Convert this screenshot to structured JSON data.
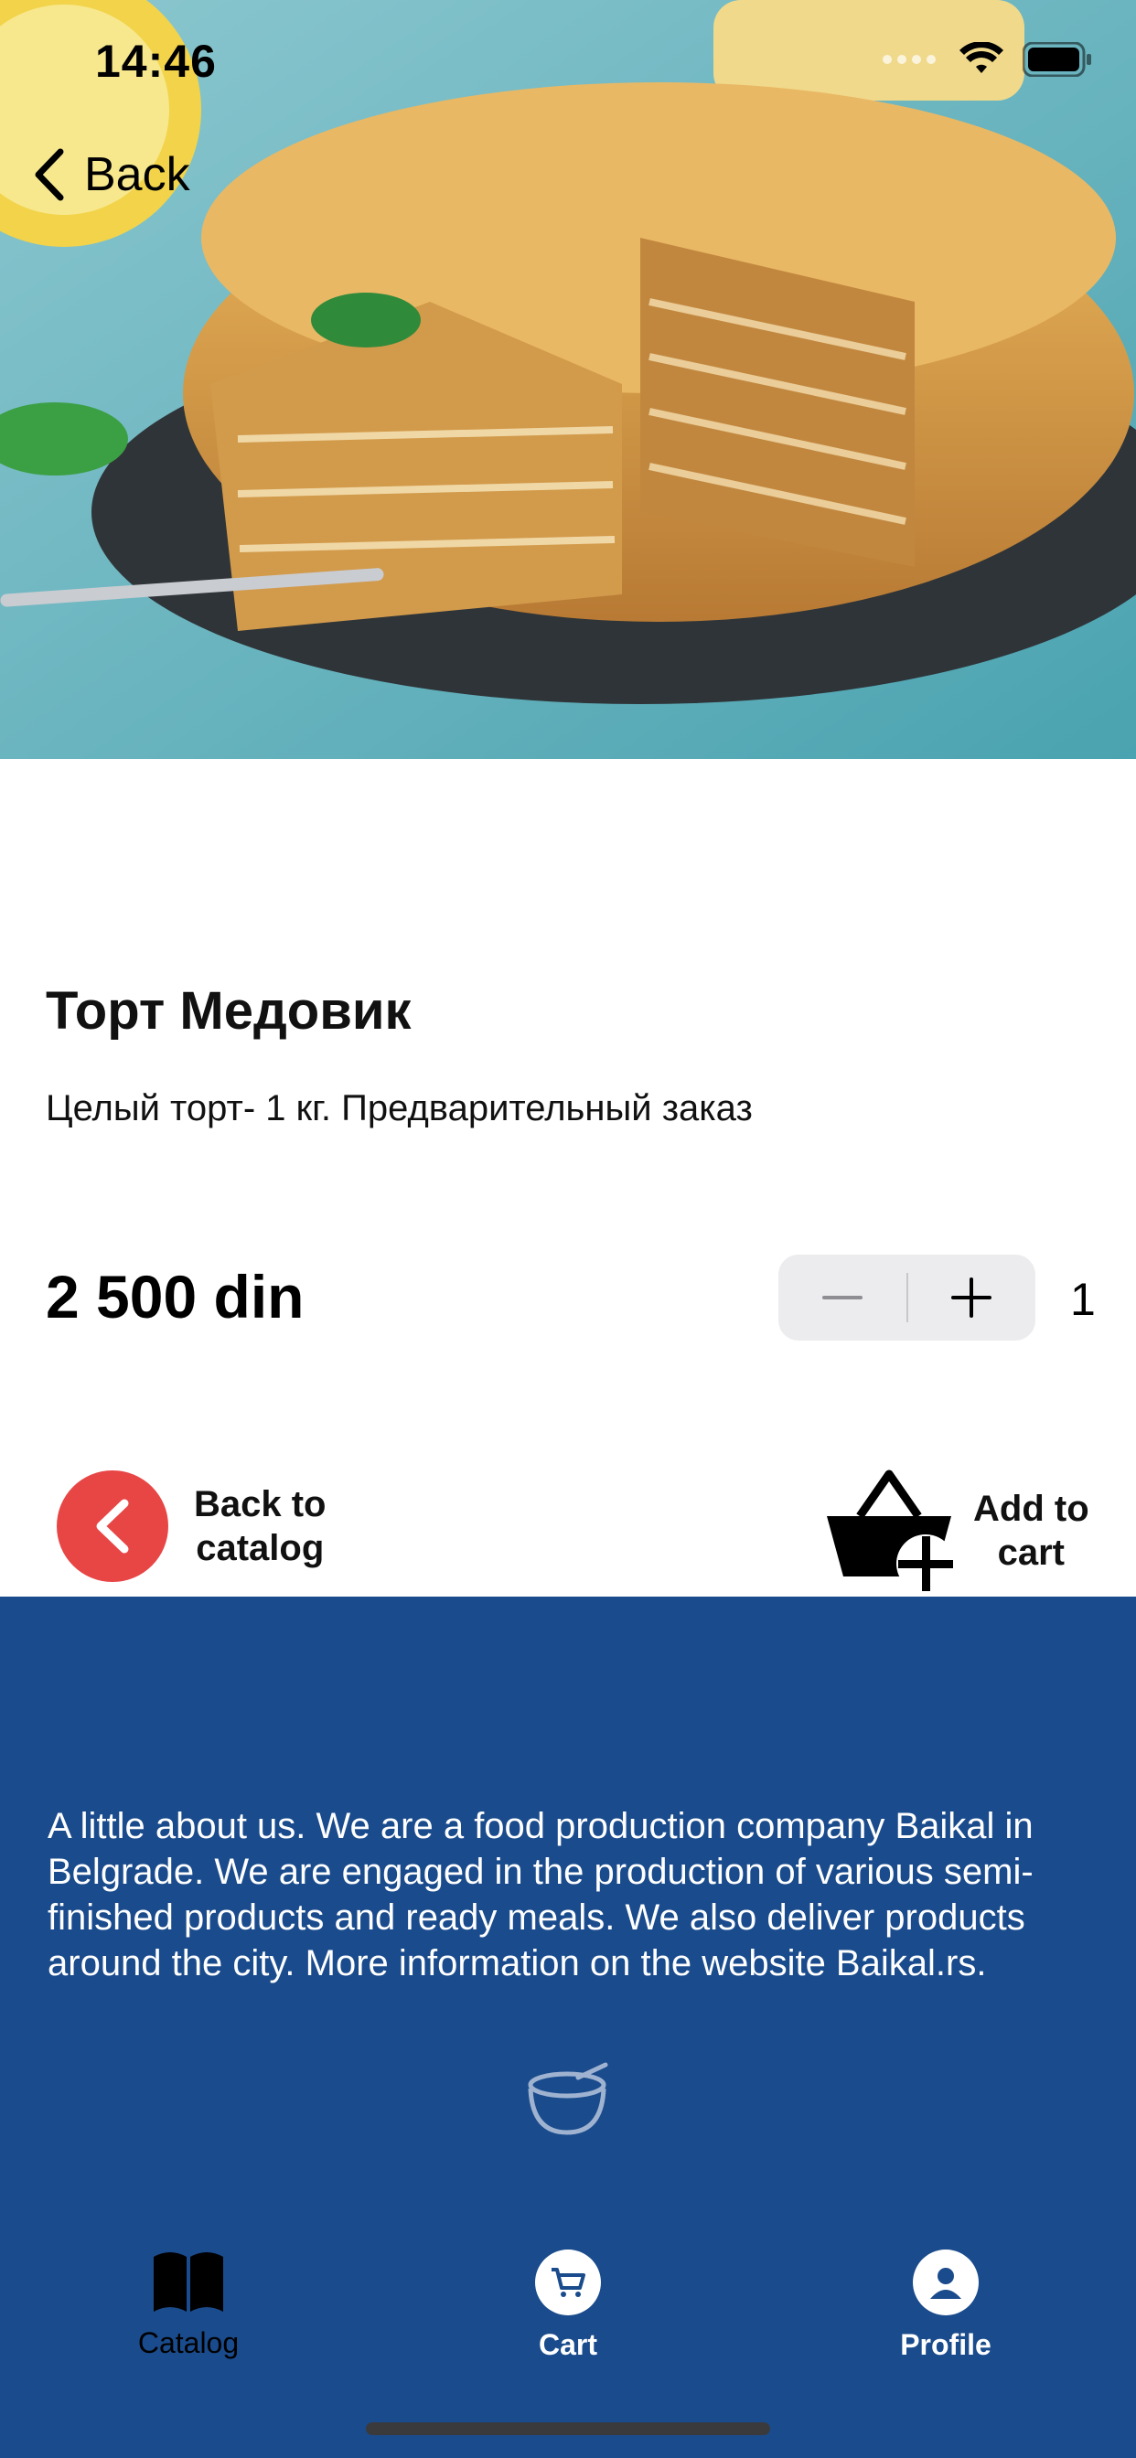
{
  "status_bar": {
    "time": "14:46",
    "icons": [
      "signal-icon",
      "wifi-icon",
      "battery-icon"
    ]
  },
  "nav": {
    "back_label": "Back"
  },
  "hero": {
    "image": "honey-cake-photo"
  },
  "product": {
    "title": "Торт Медовик",
    "description": "Целый торт- 1 кг. Предварительный заказ",
    "price": "2 500 din",
    "quantity": "1"
  },
  "actions": {
    "back_to_catalog": "Back to\ncatalog",
    "add_to_cart": "Add to\ncart"
  },
  "footer": {
    "about": "A little about us. We are a food production company Baikal in Belgrade. We are engaged in the production of various semi-finished products and ready meals. We also deliver products around the city. More information on the website Baikal.rs."
  },
  "tabbar": {
    "catalog": "Catalog",
    "cart": "Cart",
    "profile": "Profile"
  },
  "colors": {
    "footer_bg": "#1a4b8c",
    "back_button": "#e84545",
    "stepper_bg": "#ececee"
  }
}
